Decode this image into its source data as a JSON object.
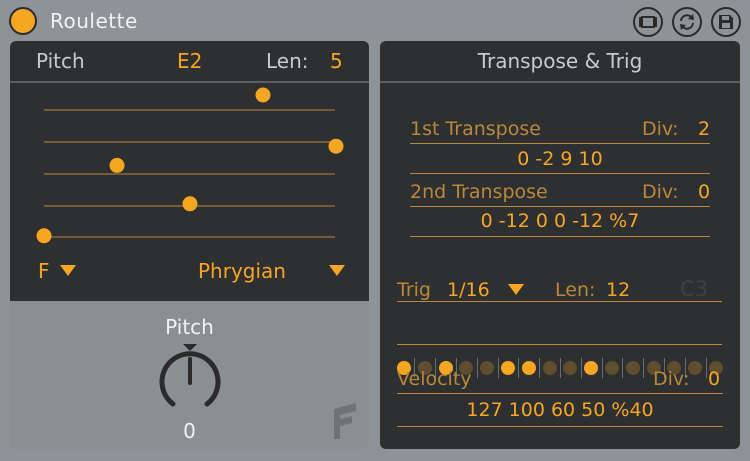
{
  "title": "Roulette",
  "header_buttons": [
    {
      "name": "fit-view-icon",
      "kind": "frame"
    },
    {
      "name": "refresh-icon",
      "kind": "cycle"
    },
    {
      "name": "save-icon",
      "kind": "disk"
    }
  ],
  "pitch_panel": {
    "pitch_label": "Pitch",
    "pitch_value": "E2",
    "len_label": "Len:",
    "len_value": "5",
    "root_note": "F",
    "scale": "Phrygian",
    "dots_note": "Step pitch dots on a 5-line staff",
    "steps": [
      {
        "step": 1,
        "line": 5.4
      },
      {
        "step": 2,
        "line": 3.2
      },
      {
        "step": 3,
        "line": 4.4
      },
      {
        "step": 4,
        "line": 1.0
      },
      {
        "step": 5,
        "line": 2.6
      }
    ]
  },
  "knob": {
    "label": "Pitch",
    "value": "0"
  },
  "transpose_panel": {
    "title": "Transpose & Trig",
    "first_label": "1st Transpose",
    "first_div_label": "Div:",
    "first_div_value": "2",
    "first_values": "0 -2 9 10",
    "second_label": "2nd Transpose",
    "second_div_label": "Div:",
    "second_div_value": "0",
    "second_values": "0 -12 0 0 -12 %7",
    "trig_label": "Trig",
    "trig_value": "1/16",
    "trig_len_label": "Len:",
    "trig_len_value": "12",
    "trig_note": "C3",
    "trig_steps": [
      1,
      0,
      1,
      0,
      0,
      1,
      1,
      0,
      0,
      1,
      0,
      0,
      0,
      0,
      0,
      0
    ],
    "velocity_label": "Velocity",
    "velocity_div_label": "Div:",
    "velocity_div_value": "0",
    "velocity_values": "127 100 60 50 %40"
  },
  "colors": {
    "accent": "#f5a623",
    "accent_dim": "#b8883c",
    "panel": "#2e2f30",
    "chrome": "#8d9396"
  }
}
